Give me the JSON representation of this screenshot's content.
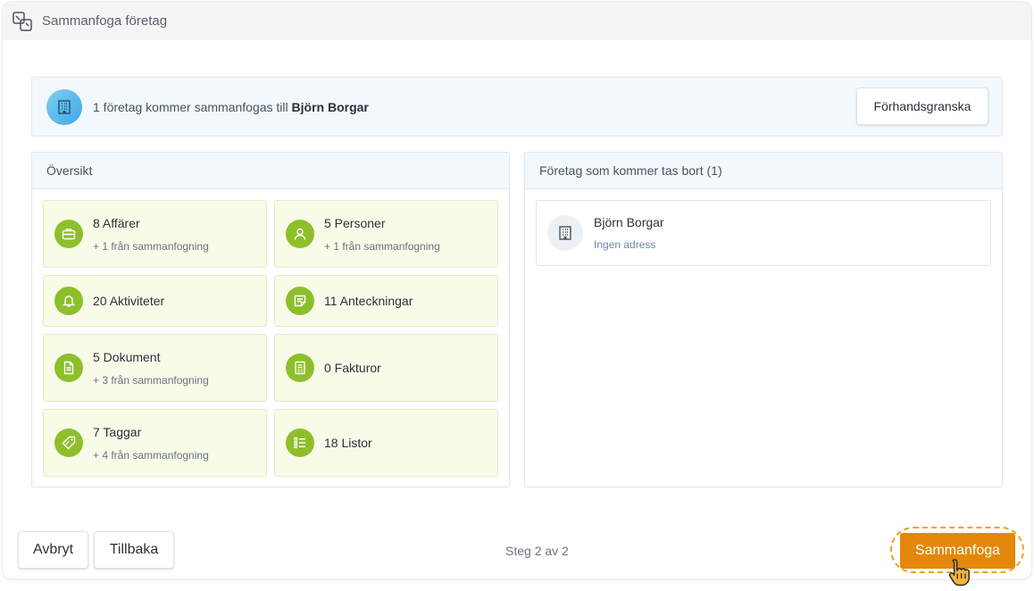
{
  "window": {
    "title": "Sammanfoga företag",
    "title_icon": "merge-icon"
  },
  "banner": {
    "text_prefix": "1 företag kommer sammanfogas till ",
    "target_name": "Björn Borgar",
    "avatar_icon": "building-icon",
    "preview_label": "Förhandsgranska"
  },
  "overview": {
    "title": "Översikt",
    "items": [
      {
        "label": "8 Affärer",
        "sub": "+ 1 från sammanfogning",
        "icon": "briefcase-icon"
      },
      {
        "label": "5 Personer",
        "sub": "+ 1 från sammanfogning",
        "icon": "person-icon"
      },
      {
        "label": "20 Aktiviteter",
        "sub": "",
        "icon": "bell-icon"
      },
      {
        "label": "11 Anteckningar",
        "sub": "",
        "icon": "note-icon"
      },
      {
        "label": "5 Dokument",
        "sub": "+ 3 från sammanfogning",
        "icon": "document-icon"
      },
      {
        "label": "0 Fakturor",
        "sub": "",
        "icon": "invoice-icon"
      },
      {
        "label": "7 Taggar",
        "sub": "+ 4 från sammanfogning",
        "icon": "tag-icon"
      },
      {
        "label": "18 Listor",
        "sub": "",
        "icon": "list-icon"
      }
    ]
  },
  "removed": {
    "title": "Företag som kommer tas bort (1)",
    "companies": [
      {
        "name": "Björn Borgar",
        "address": "Ingen adress",
        "icon": "building-icon"
      }
    ]
  },
  "footer": {
    "cancel_label": "Avbryt",
    "back_label": "Tillbaka",
    "step_text": "Steg 2 av 2",
    "merge_label": "Sammanfoga"
  },
  "colors": {
    "accent": "#e4870a",
    "stat_bg": "#f8fbe8",
    "stat_icon": "#8dbf2b",
    "banner_bg": "#f3f8fc"
  }
}
